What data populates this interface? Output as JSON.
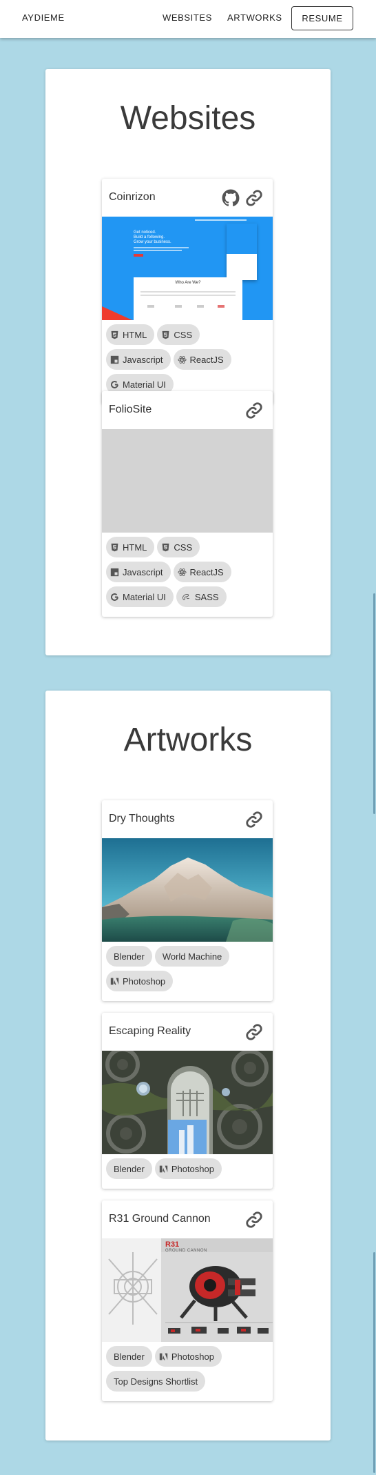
{
  "nav": {
    "brand": "AYDIEME",
    "links": [
      "WEBSITES",
      "ARTWORKS"
    ],
    "resume": "RESUME"
  },
  "websites": {
    "title": "Websites",
    "cards": [
      {
        "name": "Coinrizon",
        "chips": [
          "HTML",
          "CSS",
          "Javascript",
          "ReactJS",
          "Material UI"
        ],
        "preview": {
          "headline": [
            "Get noticed.",
            "Build a following.",
            "Grow your business."
          ],
          "section_heading": "Who Are We?"
        }
      },
      {
        "name": "FolioSite",
        "chips": [
          "HTML",
          "CSS",
          "Javascript",
          "ReactJS",
          "Material UI",
          "SASS"
        ]
      }
    ]
  },
  "artworks": {
    "title": "Artworks",
    "cards": [
      {
        "name": "Dry Thoughts",
        "chips": [
          "Blender",
          "World Machine",
          "Photoshop"
        ]
      },
      {
        "name": "Escaping Reality",
        "chips": [
          "Blender",
          "Photoshop"
        ]
      },
      {
        "name": "R31 Ground Cannon",
        "chips": [
          "Blender",
          "Photoshop",
          "Top Designs Shortlist"
        ],
        "image_text": {
          "code": "R31",
          "subtitle": "GROUND CANNON"
        }
      }
    ]
  },
  "colors": {
    "page_background": "#add8e6",
    "chip_background": "#e0e0e0",
    "coinrizon_blue": "#2196f3"
  }
}
